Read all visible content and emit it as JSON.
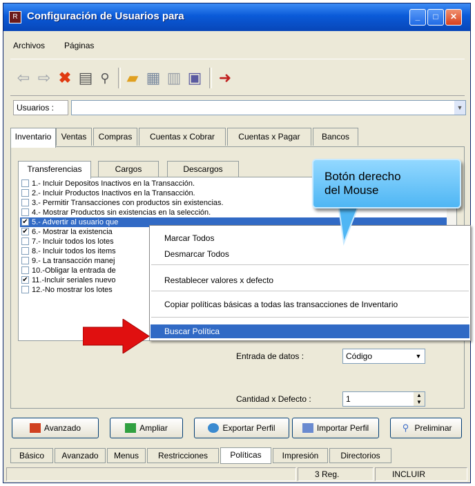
{
  "window": {
    "title": "Configuración de Usuarios para",
    "app_icon": "app-icon"
  },
  "menubar": [
    "Archivos",
    "Páginas"
  ],
  "toolbar": {
    "icons": [
      "back-arrow-icon",
      "forward-arrow-icon",
      "delete-x-icon",
      "print-icon",
      "search-icon",
      "new-folder-icon",
      "edit-document-icon",
      "trash-icon",
      "save-disk-icon",
      "exit-door-icon"
    ]
  },
  "users": {
    "label": "Usuarios :",
    "value": ""
  },
  "top_tabs": [
    "Inventario",
    "Ventas",
    "Compras",
    "Cuentas x Cobrar",
    "Cuentas x Pagar",
    "Bancos"
  ],
  "sub_tabs": [
    "Transferencias",
    "Cargos",
    "Descargos"
  ],
  "policies": [
    {
      "text": "1.- Incluir Depositos Inactivos en la Transacción.",
      "checked": false
    },
    {
      "text": "2.- Incluir Productos Inactivos en la Transacción.",
      "checked": false
    },
    {
      "text": "3.- Permitir Transacciones con productos sin existencias.",
      "checked": false
    },
    {
      "text": "4.- Mostrar Productos sin existencias en la selección.",
      "checked": false
    },
    {
      "text": "5.- Advertir al usuario que",
      "checked": true,
      "selected": true
    },
    {
      "text": "6.- Mostrar  la existencia",
      "checked": true
    },
    {
      "text": "7.- Incluir todos los lotes",
      "checked": false
    },
    {
      "text": "8.- Incluir todos los items",
      "checked": false
    },
    {
      "text": "9.- La transacción manej",
      "checked": false
    },
    {
      "text": "10.-Obligar la entrada de",
      "checked": false
    },
    {
      "text": "11.-Incluir seriales nuevo",
      "checked": true
    },
    {
      "text": "12.-No mostrar los lotes",
      "checked": false
    }
  ],
  "entrada": {
    "label": "Entrada de datos :",
    "value": "Código"
  },
  "cantidad": {
    "label": "Cantidad x Defecto :",
    "value": "1"
  },
  "buttons": [
    "Avanzado",
    "Ampliar",
    "Exportar Perfil",
    "Importar Perfil",
    "Preliminar"
  ],
  "bottom_tabs": [
    "Básico",
    "Avanzado",
    "Menus",
    "Restricciones",
    "Políticas",
    "Impresión",
    "Directorios"
  ],
  "status": {
    "reg": "3 Reg.",
    "mode": "INCLUIR"
  },
  "context_menu": [
    "Marcar Todos",
    "Desmarcar Todos",
    "Restablecer valores x defecto",
    "Copiar políticas básicas a todas las transacciones de Inventario",
    "Buscar Política"
  ],
  "callout": {
    "line1": "Botón derecho",
    "line2": "del Mouse"
  },
  "colors": {
    "titlebar": "#0a5ad8",
    "selection": "#316ac5",
    "callout": "#4fb6f4",
    "arrow": "#e01010"
  }
}
